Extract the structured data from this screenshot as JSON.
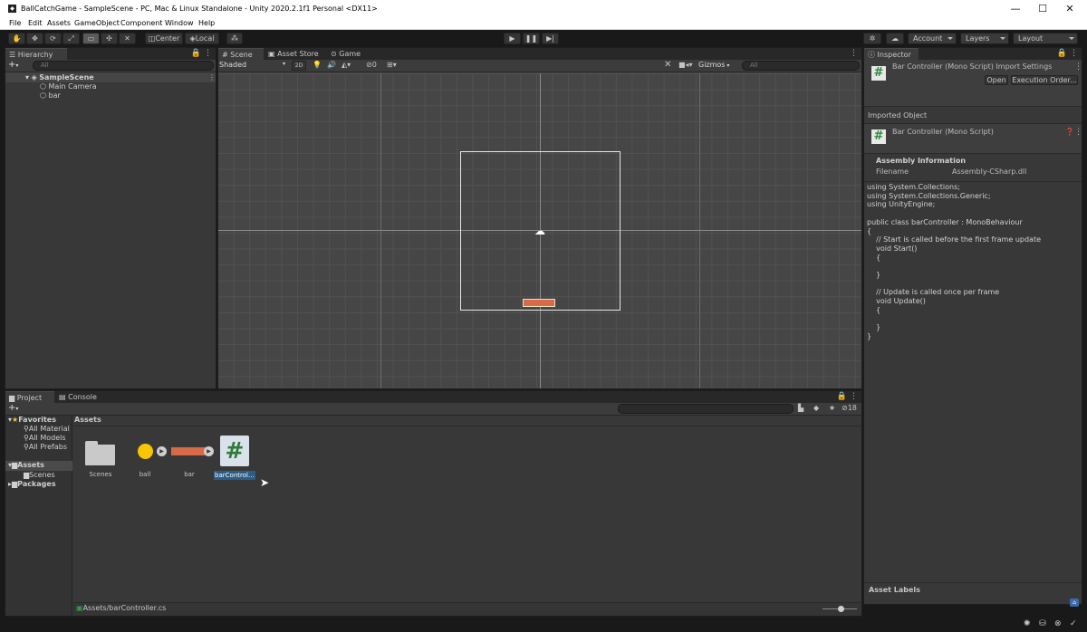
{
  "window": {
    "title": "BallCatchGame - SampleScene - PC, Mac & Linux Standalone - Unity 2020.2.1f1 Personal <DX11>",
    "minimize": "—",
    "maximize": "☐",
    "close": "✕"
  },
  "menu": [
    "File",
    "Edit",
    "Assets",
    "GameObject",
    "Component",
    "Window",
    "Help"
  ],
  "toolbar": {
    "center": "Center",
    "local": "Local",
    "account": "Account",
    "layers": "Layers",
    "layout": "Layout"
  },
  "hierarchy": {
    "tab": "Hierarchy",
    "add": "+",
    "search_placeholder": "All",
    "scene": "SampleScene",
    "items": [
      "Main Camera",
      "bar"
    ]
  },
  "scene_view": {
    "tabs": [
      "Scene",
      "Asset Store",
      "Game"
    ],
    "shading": "Shaded",
    "mode2d": "2D",
    "hidden_count": "0",
    "gizmos": "Gizmos",
    "search_placeholder": "All"
  },
  "inspector": {
    "tab": "Inspector",
    "title": "Bar Controller (Mono Script) Import Settings",
    "open": "Open",
    "execution_order": "Execution Order...",
    "imported_object": "Imported Object",
    "object_name": "Bar Controller (Mono Script)",
    "assembly_info": "Assembly Information",
    "filename_label": "Filename",
    "filename_value": "Assembly-CSharp.dll",
    "code": [
      "using System.Collections;",
      "using System.Collections.Generic;",
      "using UnityEngine;",
      "",
      "public class barController : MonoBehaviour",
      "{",
      "    // Start is called before the first frame update",
      "    void Start()",
      "    {",
      "",
      "    }",
      "",
      "    // Update is called once per frame",
      "    void Update()",
      "    {",
      "",
      "    }",
      "}"
    ],
    "asset_labels": "Asset Labels"
  },
  "project": {
    "tabs": [
      "Project",
      "Console"
    ],
    "add": "+",
    "hidden_count": "18",
    "favorites": "Favorites",
    "favorite_items": [
      "All Material",
      "All Models",
      "All Prefabs"
    ],
    "assets_root": "Assets",
    "assets_children": [
      "Scenes"
    ],
    "packages": "Packages",
    "breadcrumb": "Assets",
    "grid_items": [
      "Scenes",
      "ball",
      "bar",
      "barControl…"
    ],
    "status_path": "Assets/barController.cs"
  },
  "colors": {
    "accent": "#2c5d87",
    "bar": "#d86a4a",
    "ball": "#f9c500",
    "script_bg": "#3b5a7e"
  }
}
